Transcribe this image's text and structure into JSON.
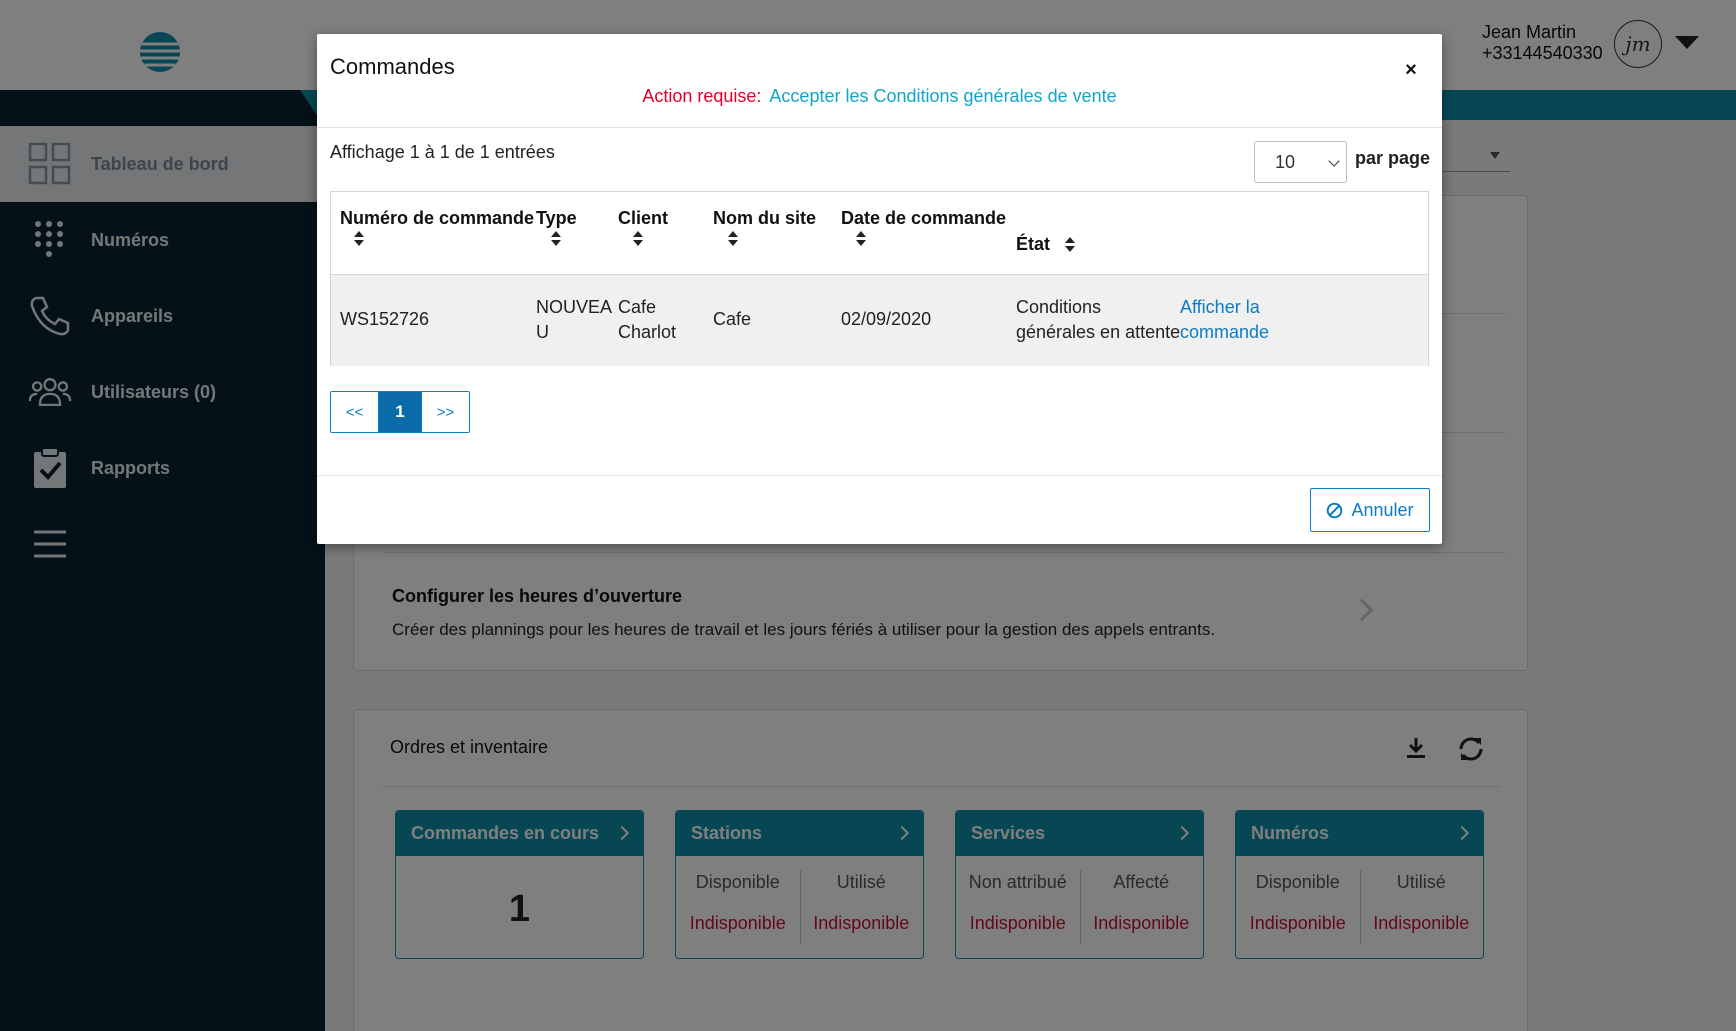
{
  "header": {
    "user_name": "Jean Martin",
    "user_phone": "+33144540330",
    "avatar_initials": "jm"
  },
  "sidebar": {
    "items": [
      {
        "label": "Tableau de bord",
        "icon": "dashboard-icon",
        "active": true
      },
      {
        "label": "Numéros",
        "icon": "dialpad-icon"
      },
      {
        "label": "Appareils",
        "icon": "phone-icon"
      },
      {
        "label": "Utilisateurs (0)",
        "icon": "users-icon"
      },
      {
        "label": "Rapports",
        "icon": "clipboard-check-icon"
      },
      {
        "label": "",
        "icon": "hamburger-menu-icon"
      }
    ]
  },
  "config_card": {
    "title": "Configurer les heures d’ouverture",
    "description": "Créer des plannings pour les heures de travail et les jours fériés à utiliser pour la gestion des appels entrants."
  },
  "orders_inventory": {
    "title": "Ordres et inventaire",
    "tiles": [
      {
        "title": "Commandes en cours",
        "value": "1"
      },
      {
        "title": "Stations",
        "cols": [
          {
            "label": "Disponible",
            "value": "Indisponible"
          },
          {
            "label": "Utilisé",
            "value": "Indisponible"
          }
        ]
      },
      {
        "title": "Services",
        "cols": [
          {
            "label": "Non attribué",
            "value": "Indisponible"
          },
          {
            "label": "Affecté",
            "value": "Indisponible"
          }
        ]
      },
      {
        "title": "Numéros",
        "cols": [
          {
            "label": "Disponible",
            "value": "Indisponible"
          },
          {
            "label": "Utilisé",
            "value": "Indisponible"
          }
        ]
      }
    ]
  },
  "modal": {
    "title": "Commandes",
    "close_label": "×",
    "action_required": "Action requise:",
    "action_link": "Accepter les Conditions générales de vente",
    "showing": "Affichage 1 à 1 de 1 entrées",
    "per_page_value": "10",
    "per_page_label": "par page",
    "columns": [
      "Numéro de commande",
      "Type",
      "Client",
      "Nom du site",
      "Date de commande",
      "État"
    ],
    "rows": [
      {
        "order_number": "WS152726",
        "type_line1": "NOUVEA",
        "type_line2": "U",
        "client_line1": "Cafe",
        "client_line2": "Charlot",
        "site": "Cafe",
        "date": "02/09/2020",
        "state_line1": "Conditions",
        "state_line2": "générales en attente",
        "action_line1": "Afficher la",
        "action_line2": "commande"
      }
    ],
    "pager": {
      "prev": "<<",
      "current": "1",
      "next": ">>"
    },
    "cancel_label": "Annuler"
  },
  "colors": {
    "brand_teal": "#0f8fa8",
    "sidebar_navy": "#0b2330",
    "link_blue": "#0e7bc4",
    "alert_red": "#e4002b",
    "unavailable_red": "#c8102e"
  }
}
